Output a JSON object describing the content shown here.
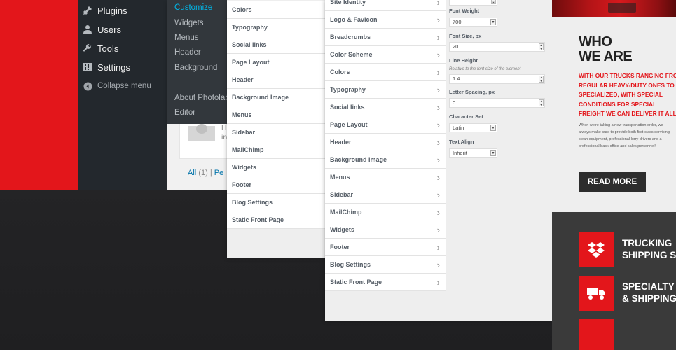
{
  "admin_menu": {
    "items": [
      {
        "label": "Plugins",
        "icon": "plugin-icon"
      },
      {
        "label": "Users",
        "icon": "user-icon"
      },
      {
        "label": "Tools",
        "icon": "wrench-icon"
      },
      {
        "label": "Settings",
        "icon": "settings-icon"
      }
    ],
    "collapse_label": "Collapse menu"
  },
  "appearance_submenu": {
    "items": [
      {
        "label": "Customize",
        "active": true
      },
      {
        "label": "Widgets"
      },
      {
        "label": "Menus"
      },
      {
        "label": "Header"
      },
      {
        "label": "Background"
      },
      {
        "label": "About Photolab"
      },
      {
        "label": "Editor"
      }
    ]
  },
  "comments": {
    "snippet_line1": "H",
    "snippet_line2": "in",
    "filter_all": "All",
    "filter_all_count": "(1)",
    "filter_sep": "|",
    "filter_next": "Pe"
  },
  "customizer_panel1": {
    "items": [
      "Colors",
      "Typography",
      "Social links",
      "Page Layout",
      "Header",
      "Background Image",
      "Menus",
      "Sidebar",
      "MailChimp",
      "Widgets",
      "Footer",
      "Blog Settings",
      "Static Front Page"
    ]
  },
  "customizer_panel2": {
    "items": [
      "Site Identity",
      "Logo & Favicon",
      "Breadcrumbs",
      "Color Scheme",
      "Colors",
      "Typography",
      "Social links",
      "Page Layout",
      "Header",
      "Background Image",
      "Menus",
      "Sidebar",
      "MailChimp",
      "Widgets",
      "Footer",
      "Blog Settings",
      "Static Front Page"
    ],
    "chevron": "›"
  },
  "typography_form": {
    "font_weight": {
      "label": "Font Weight",
      "value": "700"
    },
    "font_size": {
      "label": "Font Size, px",
      "value": "20"
    },
    "line_height": {
      "label": "Line Height",
      "desc": "Relative to the font-size of the element",
      "value": "1.4"
    },
    "letter_spacing": {
      "label": "Letter Spacing, px",
      "value": "0"
    },
    "character_set": {
      "label": "Character Set",
      "value": "Latin"
    },
    "text_align": {
      "label": "Text Align",
      "value": "Inherit"
    }
  },
  "site_preview": {
    "heading_line1": "WHO",
    "heading_line2": "WE ARE",
    "tagline": "WITH OUR TRUCKS RANGING FROM REGULAR HEAVY-DUTY ONES TO SPECIALIZED, WITH SPECIAL CONDITIONS FOR SPECIAL FREIGHT WE CAN DELIVER IT ALL!",
    "body": "When we're taking a new transportation order, we always make sure to provide both first-class servicing, clean equipment, professional lorry drivers and a professional back-office and sales personnel!",
    "button": "READ MORE",
    "services": [
      {
        "line1": "TRUCKING",
        "line2": "SHIPPING S",
        "icon": "dropbox-icon"
      },
      {
        "line1": "SPECIALTY",
        "line2": "& SHIPPING",
        "icon": "truck-icon"
      }
    ],
    "accent_color": "#e3161b"
  }
}
